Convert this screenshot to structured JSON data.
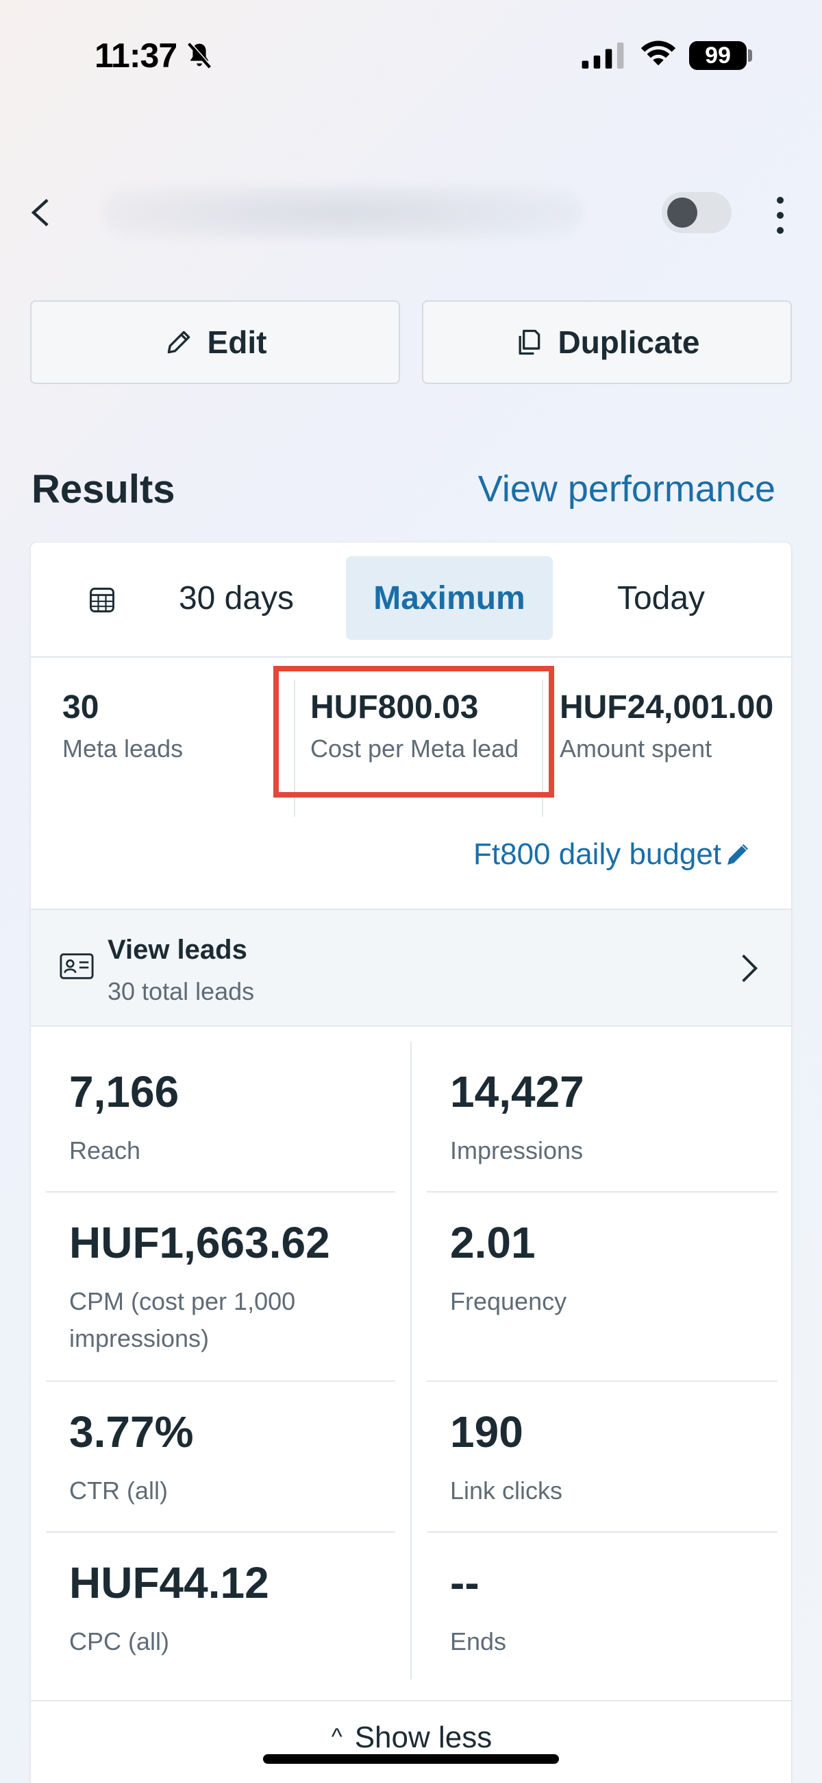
{
  "status_bar": {
    "time": "11:37",
    "battery": "99"
  },
  "actions": {
    "edit_label": "Edit",
    "duplicate_label": "Duplicate"
  },
  "results": {
    "title": "Results",
    "view_performance": "View performance"
  },
  "tabs": {
    "days": "30 days",
    "maximum": "Maximum",
    "today": "Today"
  },
  "summary": [
    {
      "value": "30",
      "label": "Meta leads"
    },
    {
      "value": "HUF800.03",
      "label": "Cost per Meta lead"
    },
    {
      "value": "HUF24,001.00",
      "label": "Amount spent"
    }
  ],
  "budget": {
    "label": "Ft800 daily budget"
  },
  "leads": {
    "title": "View leads",
    "subtitle": "30 total leads"
  },
  "metrics": [
    {
      "value": "7,166",
      "label": "Reach"
    },
    {
      "value": "14,427",
      "label": "Impressions"
    },
    {
      "value": "HUF1,663.62",
      "label": "CPM (cost per 1,000 impressions)"
    },
    {
      "value": "2.01",
      "label": "Frequency"
    },
    {
      "value": "3.77%",
      "label": "CTR (all)"
    },
    {
      "value": "190",
      "label": "Link clicks"
    },
    {
      "value": "HUF44.12",
      "label": "CPC (all)"
    },
    {
      "value": "--",
      "label": "Ends"
    }
  ],
  "show_less": "Show less",
  "colors": {
    "accent": "#1a6ea8",
    "highlight": "#e2473a",
    "tab_active_bg": "#e3edf5"
  }
}
